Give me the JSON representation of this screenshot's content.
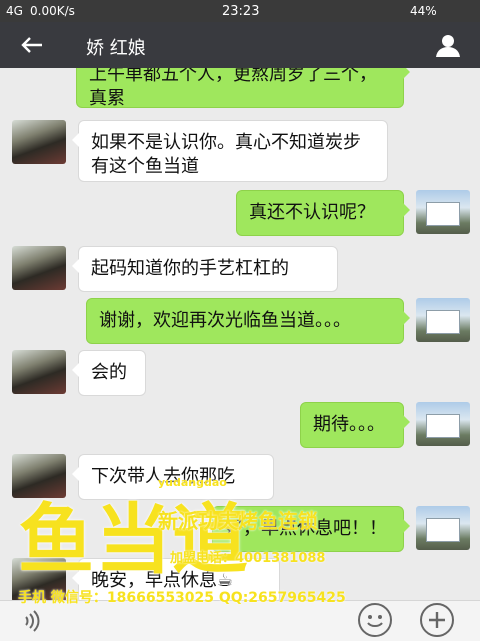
{
  "statusbar": {
    "signal_text": "4G",
    "speed": "0.00K/s",
    "time": "23:23",
    "battery": "44%"
  },
  "header": {
    "title": "娇 红娘",
    "back_icon": "back-arrow-icon",
    "profile_icon": "profile-icon"
  },
  "messages": [
    {
      "side": "right",
      "text": "上午单都五个人，更熬周岁了三个，真累"
    },
    {
      "side": "left",
      "text": "如果不是认识你。真心不知道炭步有这个鱼当道"
    },
    {
      "side": "right",
      "text": "真还不认识呢？"
    },
    {
      "side": "left",
      "text": "起码知道你的手艺杠杠的"
    },
    {
      "side": "right",
      "text": "谢谢，欢迎再次光临鱼当道。。。"
    },
    {
      "side": "left",
      "text": "会的"
    },
    {
      "side": "right",
      "text": "期待。。。"
    },
    {
      "side": "left",
      "text": "下次带人去你那吃"
    },
    {
      "side": "right",
      "text": "好，早点休息吧！！"
    },
    {
      "side": "left",
      "text": "晚安，早点休息☕"
    }
  ],
  "watermark": {
    "logo": "鱼当道",
    "url": "yudangdao",
    "slogan": "新派功夫烤鱼连锁",
    "franchise_phone": "加盟电话：4001381088",
    "contact": "手机 微信号：18666553025 QQ:2657965425"
  }
}
